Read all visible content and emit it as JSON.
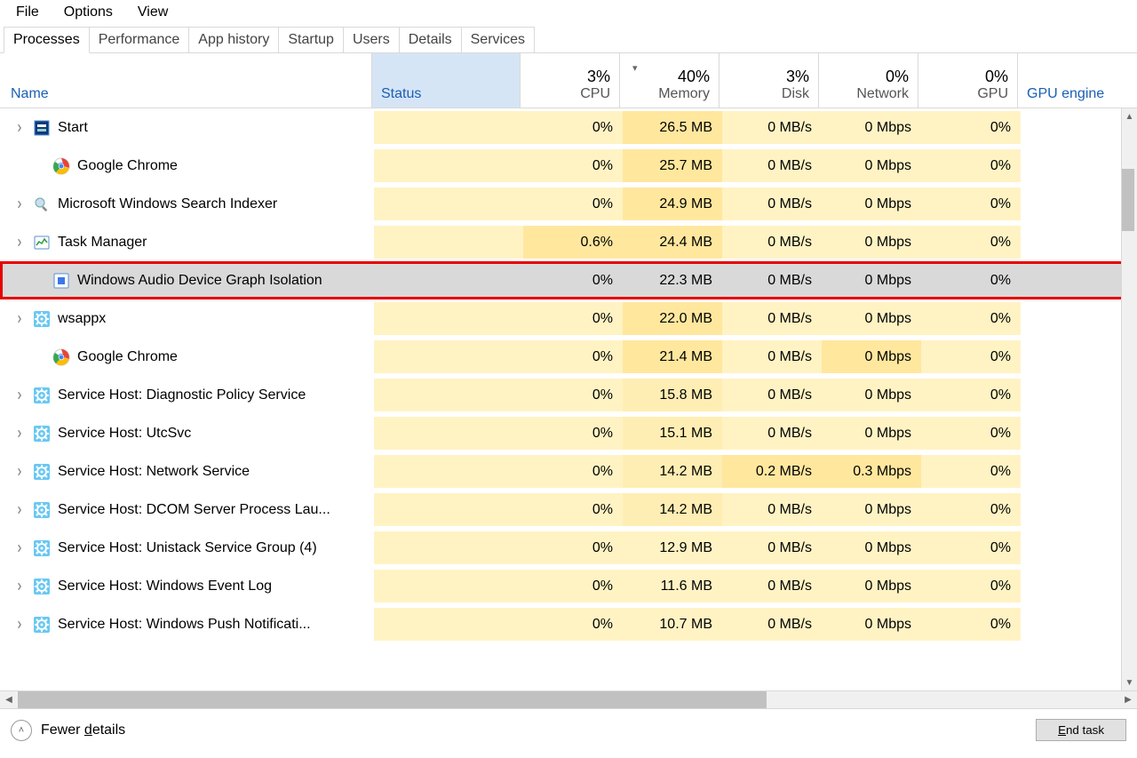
{
  "menu": {
    "file": "File",
    "options": "Options",
    "view": "View"
  },
  "tabs": {
    "processes": "Processes",
    "performance": "Performance",
    "app_history": "App history",
    "startup": "Startup",
    "users": "Users",
    "details": "Details",
    "services": "Services"
  },
  "columns": {
    "name": "Name",
    "status": "Status",
    "cpu_pct": "3%",
    "cpu": "CPU",
    "mem_pct": "40%",
    "mem": "Memory",
    "disk_pct": "3%",
    "disk": "Disk",
    "net_pct": "0%",
    "net": "Network",
    "gpu_pct": "0%",
    "gpu": "GPU",
    "gpu_engine": "GPU engine"
  },
  "rows": [
    {
      "expand": true,
      "icon": "start",
      "name": "Start",
      "cpu": "0%",
      "mem": "26.5 MB",
      "disk": "0 MB/s",
      "net": "0 Mbps",
      "gpu": "0%"
    },
    {
      "expand": false,
      "icon": "chrome",
      "name": "Google Chrome",
      "cpu": "0%",
      "mem": "25.7 MB",
      "disk": "0 MB/s",
      "net": "0 Mbps",
      "gpu": "0%"
    },
    {
      "expand": true,
      "icon": "search",
      "name": "Microsoft Windows Search Indexer",
      "cpu": "0%",
      "mem": "24.9 MB",
      "disk": "0 MB/s",
      "net": "0 Mbps",
      "gpu": "0%"
    },
    {
      "expand": true,
      "icon": "taskmgr",
      "name": "Task Manager",
      "cpu": "0.6%",
      "mem": "24.4 MB",
      "disk": "0 MB/s",
      "net": "0 Mbps",
      "gpu": "0%"
    },
    {
      "expand": false,
      "icon": "audio",
      "name": "Windows Audio Device Graph Isolation",
      "cpu": "0%",
      "mem": "22.3 MB",
      "disk": "0 MB/s",
      "net": "0 Mbps",
      "gpu": "0%"
    },
    {
      "expand": true,
      "icon": "gear",
      "name": "wsappx",
      "cpu": "0%",
      "mem": "22.0 MB",
      "disk": "0 MB/s",
      "net": "0 Mbps",
      "gpu": "0%"
    },
    {
      "expand": false,
      "icon": "chrome",
      "name": "Google Chrome",
      "cpu": "0%",
      "mem": "21.4 MB",
      "disk": "0 MB/s",
      "net": "0 Mbps",
      "gpu": "0%"
    },
    {
      "expand": true,
      "icon": "gear",
      "name": "Service Host: Diagnostic Policy Service",
      "cpu": "0%",
      "mem": "15.8 MB",
      "disk": "0 MB/s",
      "net": "0 Mbps",
      "gpu": "0%"
    },
    {
      "expand": true,
      "icon": "gear",
      "name": "Service Host: UtcSvc",
      "cpu": "0%",
      "mem": "15.1 MB",
      "disk": "0 MB/s",
      "net": "0 Mbps",
      "gpu": "0%"
    },
    {
      "expand": true,
      "icon": "gear",
      "name": "Service Host: Network Service",
      "cpu": "0%",
      "mem": "14.2 MB",
      "disk": "0.2 MB/s",
      "net": "0.3 Mbps",
      "gpu": "0%"
    },
    {
      "expand": true,
      "icon": "gear",
      "name": "Service Host: DCOM Server Process Lau...",
      "cpu": "0%",
      "mem": "14.2 MB",
      "disk": "0 MB/s",
      "net": "0 Mbps",
      "gpu": "0%"
    },
    {
      "expand": true,
      "icon": "gear",
      "name": "Service Host: Unistack Service Group (4)",
      "cpu": "0%",
      "mem": "12.9 MB",
      "disk": "0 MB/s",
      "net": "0 Mbps",
      "gpu": "0%"
    },
    {
      "expand": true,
      "icon": "gear",
      "name": "Service Host: Windows Event Log",
      "cpu": "0%",
      "mem": "11.6 MB",
      "disk": "0 MB/s",
      "net": "0 Mbps",
      "gpu": "0%"
    },
    {
      "expand": true,
      "icon": "gear",
      "name": "Service Host: Windows Push Notificati...",
      "cpu": "0%",
      "mem": "10.7 MB",
      "disk": "0 MB/s",
      "net": "0 Mbps",
      "gpu": "0%"
    }
  ],
  "footer": {
    "fewer_details": "Fewer details",
    "end_task": "End task"
  },
  "colors": {
    "yellow_light": "#fff3c4",
    "yellow_med": "#ffeeb3",
    "yellow_dark": "#ffe79e"
  }
}
